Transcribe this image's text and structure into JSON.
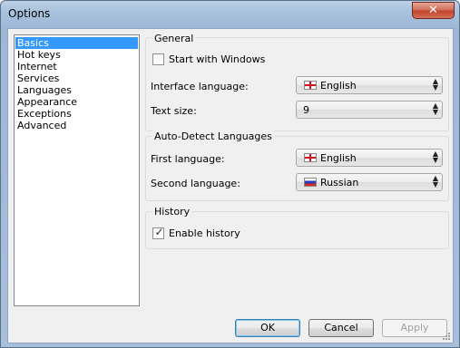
{
  "window": {
    "title": "Options",
    "close_glyph": "✕"
  },
  "nav": {
    "items": [
      {
        "label": "Basics",
        "selected": true
      },
      {
        "label": "Hot keys"
      },
      {
        "label": "Internet"
      },
      {
        "label": "Services"
      },
      {
        "label": "Languages"
      },
      {
        "label": "Appearance"
      },
      {
        "label": "Exceptions"
      },
      {
        "label": "Advanced"
      }
    ]
  },
  "general": {
    "title": "General",
    "start_with_windows": {
      "label": "Start with Windows",
      "checked": false
    },
    "interface_language": {
      "label": "Interface language:",
      "value": "English",
      "flag": "english-flag-icon"
    },
    "text_size": {
      "label": "Text size:",
      "value": "9"
    }
  },
  "auto_detect": {
    "title": "Auto-Detect Languages",
    "first_language": {
      "label": "First language:",
      "value": "English",
      "flag": "english-flag-icon"
    },
    "second_language": {
      "label": "Second language:",
      "value": "Russian",
      "flag": "russian-flag-icon"
    }
  },
  "history": {
    "title": "History",
    "enable_history": {
      "label": "Enable history",
      "checked": true,
      "check_glyph": "✓"
    }
  },
  "buttons": {
    "ok": "OK",
    "cancel": "Cancel",
    "apply": "Apply"
  },
  "colors": {
    "selection": "#3399ff",
    "dialog_bg": "#f0f0f0"
  }
}
